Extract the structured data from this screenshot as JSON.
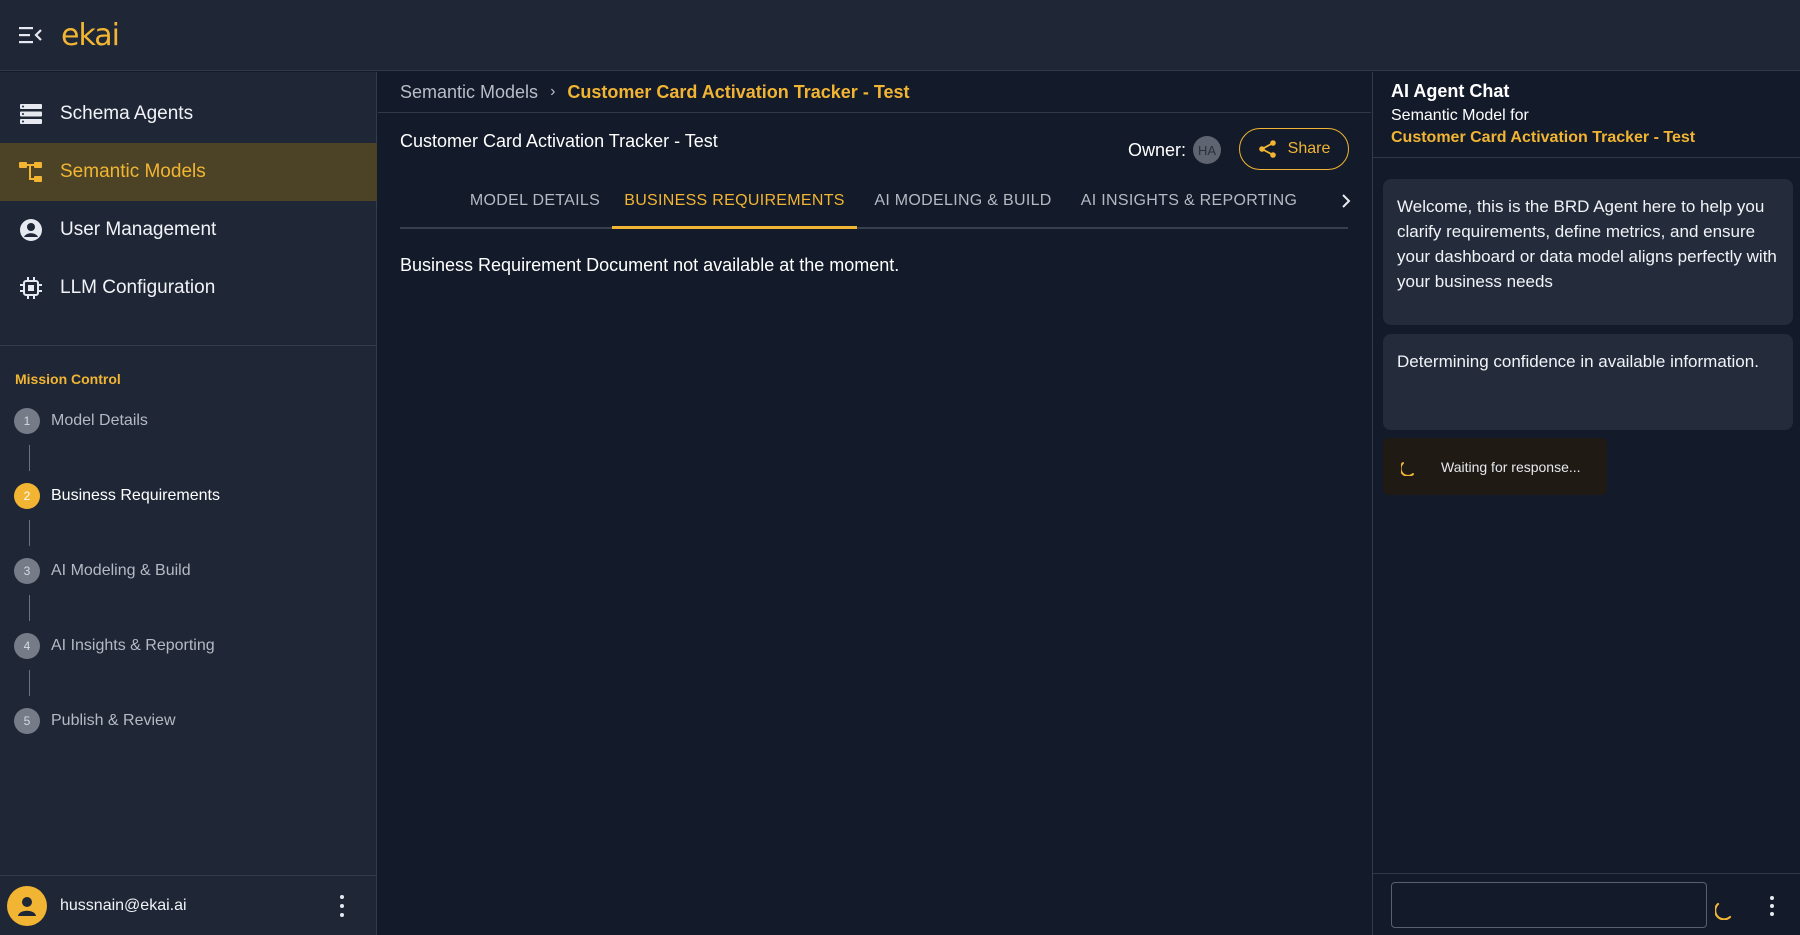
{
  "app": {
    "logo_text": "ekai",
    "accent_color": "#f2b533"
  },
  "sidebar": {
    "nav": [
      {
        "label": "Schema Agents",
        "icon": "list-icon"
      },
      {
        "label": "Semantic Models",
        "icon": "hierarchy-icon",
        "active": true
      },
      {
        "label": "User Management",
        "icon": "user-circle-icon"
      },
      {
        "label": "LLM Configuration",
        "icon": "chip-icon"
      }
    ],
    "mission_title": "Mission Control",
    "steps": [
      {
        "num": "1",
        "label": "Model Details"
      },
      {
        "num": "2",
        "label": "Business Requirements",
        "active": true
      },
      {
        "num": "3",
        "label": "AI Modeling & Build"
      },
      {
        "num": "4",
        "label": "AI Insights & Reporting"
      },
      {
        "num": "5",
        "label": "Publish & Review"
      }
    ],
    "user_email": "hussnain@ekai.ai"
  },
  "main": {
    "breadcrumb": {
      "parent": "Semantic Models",
      "separator": "›",
      "current": "Customer Card Activation Tracker - Test"
    },
    "title": "Customer Card Activation Tracker - Test",
    "owner_label": "Owner:",
    "owner_initials": "HA",
    "share_label": "Share",
    "tabs": [
      {
        "label": "MODEL DETAILS"
      },
      {
        "label": "BUSINESS REQUIREMENTS",
        "active": true
      },
      {
        "label": "AI MODELING & BUILD"
      },
      {
        "label": "AI INSIGHTS & REPORTING"
      }
    ],
    "empty_message": "Business Requirement Document not available at the moment."
  },
  "chat": {
    "title": "AI Agent Chat",
    "subtitle": "Semantic Model for",
    "model_name": "Customer Card Activation Tracker - Test",
    "messages": [
      {
        "text": "Welcome, this is the BRD Agent here to help you clarify requirements, define metrics, and ensure your dashboard or data model aligns perfectly with your business needs"
      },
      {
        "text": "Determining confidence in available information."
      }
    ],
    "waiting_text": "Waiting for response...",
    "input_value": ""
  }
}
